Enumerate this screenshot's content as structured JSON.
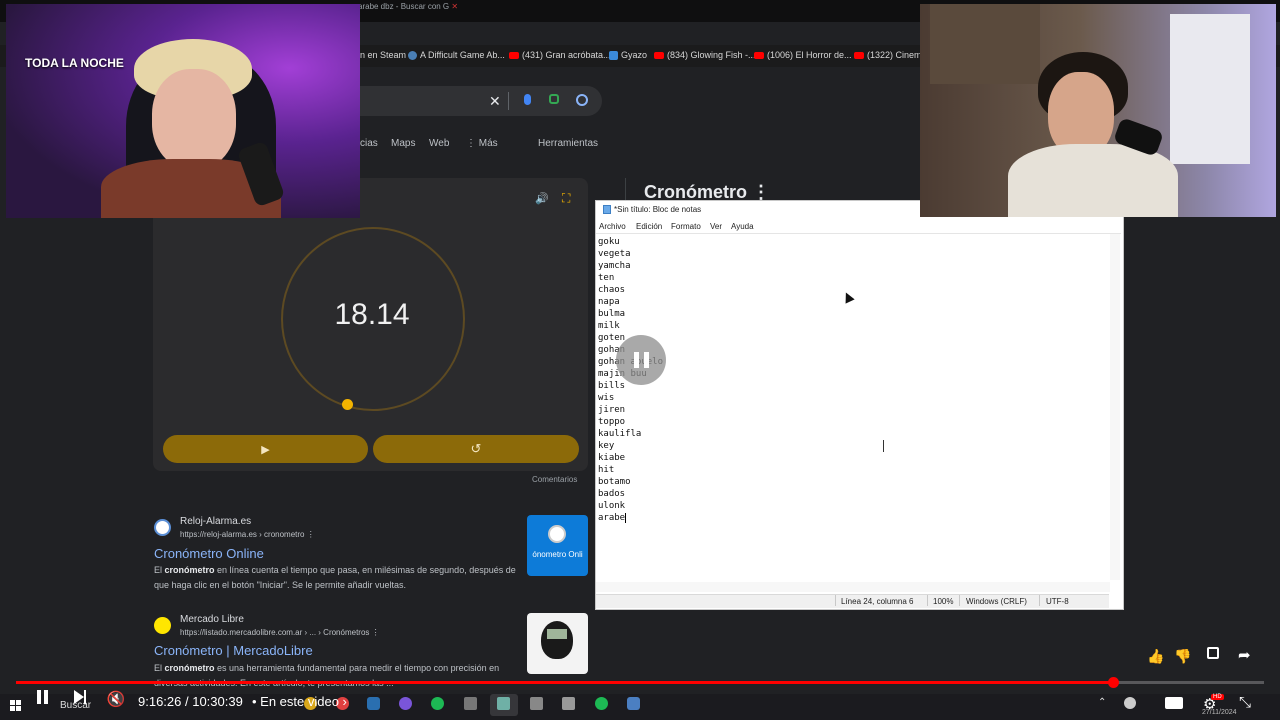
{
  "browser": {
    "tab_title": "arabe dbz - Buscar con G",
    "bookmarks": [
      {
        "label": "n en Steam",
        "icon": "steam-icon"
      },
      {
        "label": "A Difficult Game Ab...",
        "icon": "steam-icon"
      },
      {
        "label": "(431) Gran acróbata...",
        "icon": "youtube-icon"
      },
      {
        "label": "Gyazo",
        "icon": "gyazo-icon"
      },
      {
        "label": "(834) Glowing Fish -...",
        "icon": "youtube-icon"
      },
      {
        "label": "(1006) El Horror de...",
        "icon": "youtube-icon"
      },
      {
        "label": "(1322) Cinema",
        "icon": "youtube-icon"
      }
    ],
    "search_nav": [
      "cias",
      "Maps",
      "Web",
      "⋮ Más",
      "Herramientas"
    ],
    "stopwatch": {
      "time": "18.14",
      "play_icon": "▶",
      "reset_icon": "↺",
      "sound_icon": "🔊",
      "fullscreen_icon": "⛶",
      "comments_label": "Comentarios"
    },
    "knowledge_title": "Cronómetro ⋮",
    "results": [
      {
        "site": "Reloj-Alarma.es",
        "url": "https://reloj-alarma.es › cronometro",
        "title": "Cronómetro Online",
        "snippet_bold": "cronómetro",
        "snippet_pre": "El ",
        "snippet_post": " en línea cuenta el tiempo que pasa, en milésimas de segundo, después de que haga clic en el botón \"Iniciar\". Se le permite añadir vueltas.",
        "thumb_text": "ónometro Onli"
      },
      {
        "site": "Mercado Libre",
        "url": "https://listado.mercadolibre.com.ar › ... › Cronómetros",
        "title": "Cronómetro | MercadoLibre",
        "snippet_bold": "cronómetro",
        "snippet_pre": "El ",
        "snippet_post": " es una herramienta fundamental para medir el tiempo con precisión en diversas actividades. En este artículo, te presentamos las ..."
      }
    ]
  },
  "notepad": {
    "title": "*Sin título: Bloc de notas",
    "menu": [
      "Archivo",
      "Edición",
      "Formato",
      "Ver",
      "Ayuda"
    ],
    "lines": [
      "goku",
      "vegeta",
      "yamcha",
      "ten",
      "chaos",
      "napa",
      "bulma",
      "milk",
      "goten",
      "gohan",
      "gohan abuelo",
      "majin buu",
      "bills",
      "wis",
      "jiren",
      "toppo",
      "kaulifla",
      "key",
      "kiabe",
      "hit",
      "botamo",
      "bados",
      "ulonk",
      "arabe"
    ],
    "status": {
      "position": "Línea 24, columna 6",
      "zoom": "100%",
      "line_endings": "Windows (CRLF)",
      "encoding": "UTF-8"
    }
  },
  "stream": {
    "overlay_text": "TODA LA NOCHE"
  },
  "player": {
    "progress": 0.879,
    "time": "9:16:26 / 10:30:39",
    "chapter": "• En este video ›",
    "colors": {
      "accent": "#ff0000"
    }
  },
  "taskbar": {
    "search_label": "Buscar",
    "date": "27/11/2024"
  }
}
